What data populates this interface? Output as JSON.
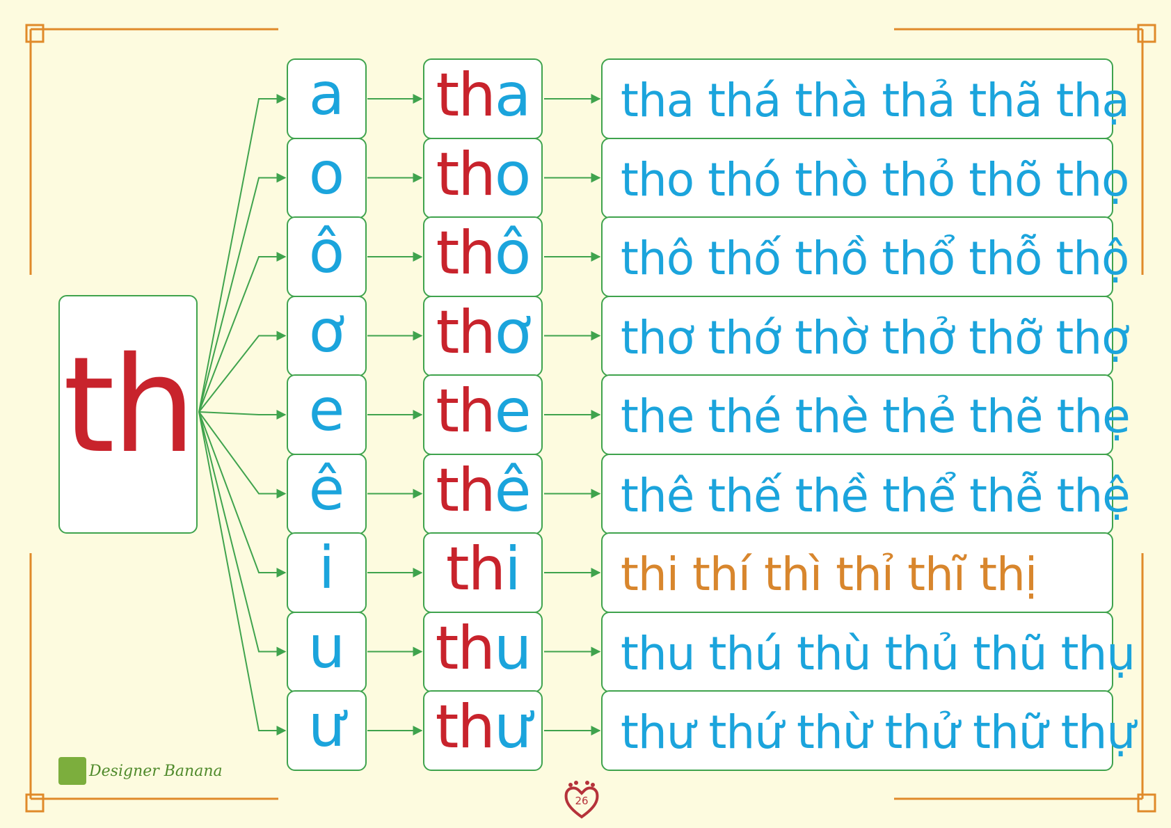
{
  "colors": {
    "background": "#fdfbdf",
    "border": "#3fa34d",
    "consonant": "#c8232c",
    "vowel": "#1ba4dc",
    "highlight": "#d8862d",
    "frame": "#e08a2a"
  },
  "consonant": "th",
  "rows": [
    {
      "vowel": "a",
      "syllable": "tha",
      "variants": "tha thá thà thả thã thạ",
      "highlight": false
    },
    {
      "vowel": "o",
      "syllable": "tho",
      "variants": "tho thó thò thỏ thõ thọ",
      "highlight": false
    },
    {
      "vowel": "ô",
      "syllable": "thô",
      "variants": "thô thố thồ thổ thỗ thộ",
      "highlight": false
    },
    {
      "vowel": "ơ",
      "syllable": "thơ",
      "variants": "thơ thớ thờ thở thỡ thợ",
      "highlight": false
    },
    {
      "vowel": "e",
      "syllable": "the",
      "variants": "the thé thè thẻ thẽ thẹ",
      "highlight": false
    },
    {
      "vowel": "ê",
      "syllable": "thê",
      "variants": "thê thế thề thể thễ thệ",
      "highlight": false
    },
    {
      "vowel": "i",
      "syllable": "thi",
      "variants": "thi  thí  thì  thỉ  thĩ  thị",
      "highlight": true
    },
    {
      "vowel": "u",
      "syllable": "thu",
      "variants": "thu thú thù thủ thũ thụ",
      "highlight": false
    },
    {
      "vowel": "ư",
      "syllable": "thư",
      "variants": "thư thứ thừ thử thữ thự",
      "highlight": false
    }
  ],
  "footer": {
    "logo_text": "Designer Banana",
    "logo_icon": "banana-logo-icon",
    "page_number": "26",
    "page_icon": "heart-footprint-icon"
  }
}
